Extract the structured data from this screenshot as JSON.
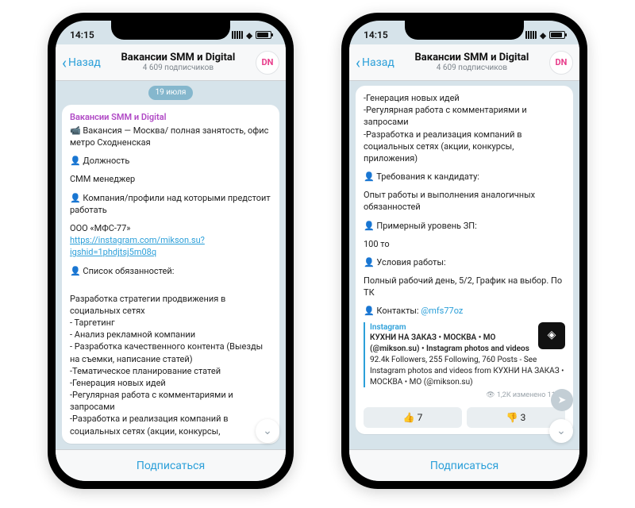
{
  "statusbar": {
    "time": "14:15"
  },
  "header": {
    "back": "Назад",
    "title": "Вакансии SMM и Digital",
    "subtitle": "4 609 подписчиков",
    "avatar": "DN"
  },
  "left": {
    "date": "19 июля",
    "channel": "Вакансии SMM и Digital",
    "line1": "📹 Вакансия — Москва/ полная занятость, офис метро Сходненская",
    "role_h": "👤 Должность",
    "role": "СММ менеджер",
    "company_h": "👤 Компания/профили над которыми предстоит работать",
    "company": "ООО «МФС-77»",
    "company_link": "https://instagram.com/mikson.su?igshid=1phdjtsj5m08q",
    "duties_h": "👤 Список обязанностей:",
    "duties_intro": "Разработка стратегии продвижения в социальных сетях",
    "duties": [
      "- Таргетинг",
      "- Анализ рекламной компании",
      "- Разработка качественного контента (Выезды на съемки, написание статей)",
      "-Тематическое планирование статей",
      "-Генерация новых идей",
      "-Регулярная работа с комментариями и запросами",
      "-Разработка и реализация компаний в социальных сетях (акции, конкурсы,"
    ]
  },
  "right": {
    "top_lines": [
      "-Генерация новых идей",
      "-Регулярная работа с комментариями и запросами",
      "-Разработка и реализация компаний в социальных сетях (акции, конкурсы, приложения)"
    ],
    "req_h": "👤 Требования к кандидату:",
    "req": "Опыт работы и выполнения аналогичных обязанностей",
    "salary_h": "👤 Примерный уровень ЗП:",
    "salary": "100 то",
    "cond_h": "👤 Условия работы:",
    "cond": "Полный рабочий день, 5/2, График на выбор. По ТК",
    "contacts_h": "👤 Контакты:",
    "contacts_handle": "@mfs77oz",
    "quote_title": "Instagram",
    "quote_bold": "КУХНИ НА ЗАКАЗ • МОСКВА • МО (@mikson.su) • Instagram photos and videos",
    "quote_text": "92.4k Followers, 255 Following, 760 Posts - See Instagram photos and videos from КУХНИ НА ЗАКАЗ • МОСКВА • МО (@mikson.su)",
    "meta": "👁 1,2К изменено 11:00",
    "reactions": [
      {
        "emoji": "👍",
        "count": "7"
      },
      {
        "emoji": "👎",
        "count": "3"
      }
    ]
  },
  "subscribe": "Подписаться"
}
